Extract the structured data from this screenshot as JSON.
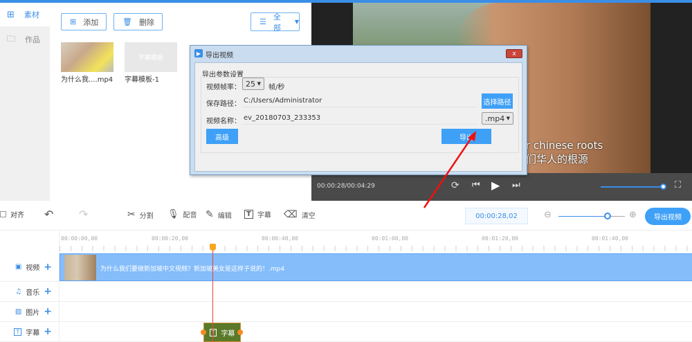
{
  "sidebar": {
    "items": [
      {
        "label": "素材",
        "icon": "grid-icon",
        "active": true
      },
      {
        "label": "作品",
        "icon": "folder-icon",
        "active": false
      }
    ]
  },
  "library": {
    "add_label": "添加",
    "delete_label": "删除",
    "filter_value": "全部",
    "items": [
      {
        "caption": "为什么我....mp4"
      },
      {
        "caption": "字幕模板-1",
        "thumb_text": "字幕模板"
      }
    ]
  },
  "player": {
    "subtitle_en": "r chinese roots",
    "subtitle_zh": "们华人的根源",
    "time": "00:00:28/00:04:29",
    "volume": 1.0
  },
  "dialog": {
    "title": "导出视频",
    "group_label": "导出参数设置",
    "fps_label": "视频帧率：",
    "fps_value": "25",
    "fps_unit": "帧/秒",
    "path_label": "保存路径：",
    "path_value": "C:/Users/Administrator",
    "choose_path_label": "选择路径",
    "name_label": "视频名称：",
    "name_value": "ev_20180703_233353",
    "format_value": ".mp4",
    "advanced_label": "高级",
    "export_label": "导出",
    "close_label": "x"
  },
  "toolbar": {
    "align_label": "对齐",
    "split_label": "分割",
    "dub_label": "配音",
    "edit_label": "编辑",
    "subtitle_label": "字幕",
    "clear_label": "清空",
    "timecode": "00:00:28,02",
    "zoom_level": 0.75,
    "export_video_label": "导出视频"
  },
  "timeline": {
    "ticks": [
      "00:00:00,00",
      "00:00:20,00",
      "00:00:40,00",
      "00:01:00,00",
      "00:01:20,00",
      "00:01:40,00"
    ],
    "tracks": [
      {
        "label": "视频",
        "icon": "video-icon"
      },
      {
        "label": "音乐",
        "icon": "music-icon"
      },
      {
        "label": "图片",
        "icon": "image-icon"
      },
      {
        "label": "字幕",
        "icon": "text-icon"
      }
    ],
    "video_clip_title": "为什么我们要做新加坡中文视频？新加坡美女是这样子说的！.mp4",
    "subtitle_clip_label": "字幕"
  },
  "colors": {
    "accent": "#3a8ee6",
    "clip_video": "#85bdfb",
    "clip_subtitle": "#5a7a2a",
    "playhead": "#f04040"
  }
}
